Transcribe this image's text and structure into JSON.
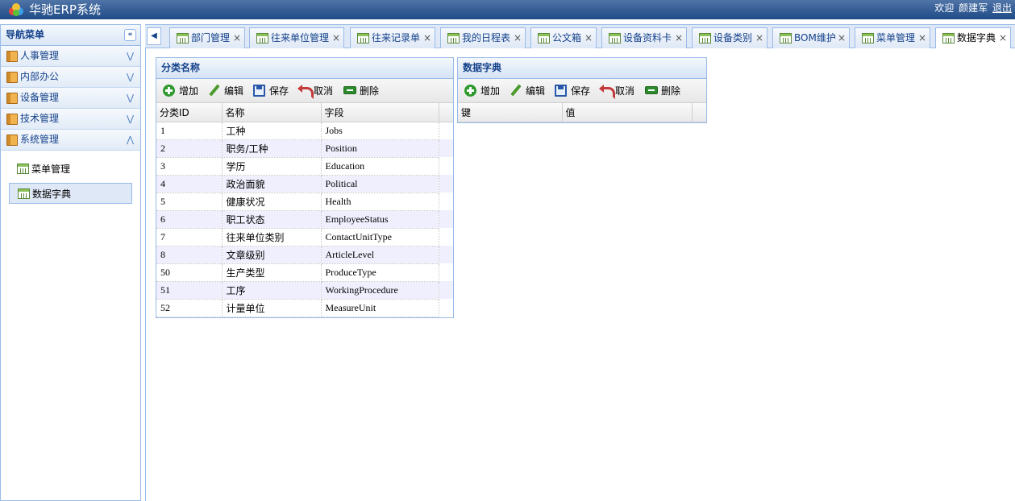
{
  "app": {
    "title": "华驰ERP系统",
    "welcome": "欢迎",
    "user": "颜建军",
    "logout": "退出"
  },
  "nav": {
    "title": "导航菜单",
    "sections": [
      {
        "label": "人事管理",
        "expanded": false
      },
      {
        "label": "内部办公",
        "expanded": false
      },
      {
        "label": "设备管理",
        "expanded": false
      },
      {
        "label": "技术管理",
        "expanded": false
      },
      {
        "label": "系统管理",
        "expanded": true
      }
    ],
    "items": [
      {
        "label": "菜单管理",
        "active": false
      },
      {
        "label": "数据字典",
        "active": true
      }
    ]
  },
  "tabs": [
    {
      "label": "部门管理",
      "active": false
    },
    {
      "label": "往来单位管理",
      "active": false
    },
    {
      "label": "往来记录单",
      "active": false
    },
    {
      "label": "我的日程表",
      "active": false
    },
    {
      "label": "公文箱",
      "active": false
    },
    {
      "label": "设备资料卡",
      "active": false
    },
    {
      "label": "设备类别",
      "active": false
    },
    {
      "label": "BOM维护",
      "active": false
    },
    {
      "label": "菜单管理",
      "active": false
    },
    {
      "label": "数据字典",
      "active": true
    }
  ],
  "toolbar": {
    "add": "增加",
    "edit": "编辑",
    "save": "保存",
    "cancel": "取消",
    "delete": "删除"
  },
  "category_grid": {
    "title": "分类名称",
    "columns": [
      "分类ID",
      "名称",
      "字段"
    ],
    "rows": [
      [
        "1",
        "工种",
        "Jobs"
      ],
      [
        "2",
        "职务/工种",
        "Position"
      ],
      [
        "3",
        "学历",
        "Education"
      ],
      [
        "4",
        "政治面貌",
        "Political"
      ],
      [
        "5",
        "健康状况",
        "Health"
      ],
      [
        "6",
        "职工状态",
        "EmployeeStatus"
      ],
      [
        "7",
        "往来单位类别",
        "ContactUnitType"
      ],
      [
        "8",
        "文章级别",
        "ArticleLevel"
      ],
      [
        "50",
        "生产类型",
        "ProduceType"
      ],
      [
        "51",
        "工序",
        "WorkingProcedure"
      ],
      [
        "52",
        "计量单位",
        "MeasureUnit"
      ]
    ]
  },
  "dictionary_grid": {
    "title": "数据字典",
    "columns": [
      "键",
      "值"
    ],
    "rows": []
  },
  "colors": {
    "header": "#1f4b86",
    "panel_border": "#99bbe8",
    "title_text": "#15428b",
    "alt_row": "#f0effe"
  }
}
